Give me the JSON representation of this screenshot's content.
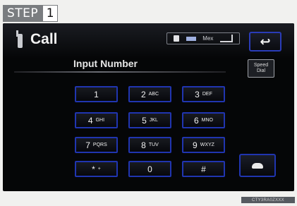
{
  "step": {
    "word": "STEP",
    "number": "1"
  },
  "header": {
    "title": "Call",
    "back_symbol": "↩"
  },
  "status": {
    "carrier": "Mex"
  },
  "input": {
    "label": "Input Number"
  },
  "speed_dial": {
    "label_line1": "Speed",
    "label_line2": "Dial"
  },
  "keypad": [
    {
      "main": "1",
      "sub": ""
    },
    {
      "main": "2",
      "sub": "ABC"
    },
    {
      "main": "3",
      "sub": "DEF"
    },
    {
      "main": "4",
      "sub": "GHI"
    },
    {
      "main": "5",
      "sub": "JKL"
    },
    {
      "main": "6",
      "sub": "MNO"
    },
    {
      "main": "7",
      "sub": "PQRS"
    },
    {
      "main": "8",
      "sub": "TUV"
    },
    {
      "main": "9",
      "sub": "WXYZ"
    },
    {
      "main": "*",
      "sub": "+"
    },
    {
      "main": "0",
      "sub": ""
    },
    {
      "main": "#",
      "sub": ""
    }
  ],
  "watermark": "CTY3RA0ZXXX"
}
